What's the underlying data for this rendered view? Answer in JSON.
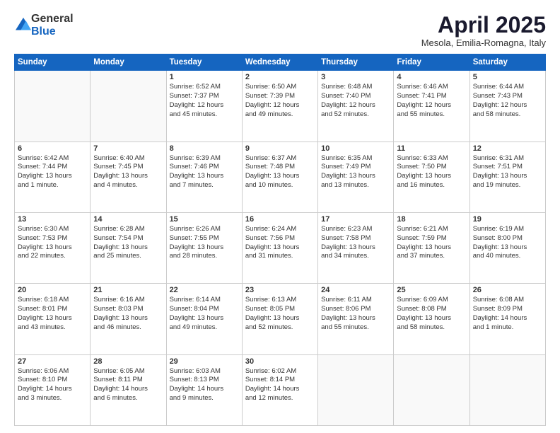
{
  "header": {
    "logo_general": "General",
    "logo_blue": "Blue",
    "month_title": "April 2025",
    "location": "Mesola, Emilia-Romagna, Italy"
  },
  "days_of_week": [
    "Sunday",
    "Monday",
    "Tuesday",
    "Wednesday",
    "Thursday",
    "Friday",
    "Saturday"
  ],
  "weeks": [
    [
      {
        "day": "",
        "content": ""
      },
      {
        "day": "",
        "content": ""
      },
      {
        "day": "1",
        "content": "Sunrise: 6:52 AM\nSunset: 7:37 PM\nDaylight: 12 hours\nand 45 minutes."
      },
      {
        "day": "2",
        "content": "Sunrise: 6:50 AM\nSunset: 7:39 PM\nDaylight: 12 hours\nand 49 minutes."
      },
      {
        "day": "3",
        "content": "Sunrise: 6:48 AM\nSunset: 7:40 PM\nDaylight: 12 hours\nand 52 minutes."
      },
      {
        "day": "4",
        "content": "Sunrise: 6:46 AM\nSunset: 7:41 PM\nDaylight: 12 hours\nand 55 minutes."
      },
      {
        "day": "5",
        "content": "Sunrise: 6:44 AM\nSunset: 7:43 PM\nDaylight: 12 hours\nand 58 minutes."
      }
    ],
    [
      {
        "day": "6",
        "content": "Sunrise: 6:42 AM\nSunset: 7:44 PM\nDaylight: 13 hours\nand 1 minute."
      },
      {
        "day": "7",
        "content": "Sunrise: 6:40 AM\nSunset: 7:45 PM\nDaylight: 13 hours\nand 4 minutes."
      },
      {
        "day": "8",
        "content": "Sunrise: 6:39 AM\nSunset: 7:46 PM\nDaylight: 13 hours\nand 7 minutes."
      },
      {
        "day": "9",
        "content": "Sunrise: 6:37 AM\nSunset: 7:48 PM\nDaylight: 13 hours\nand 10 minutes."
      },
      {
        "day": "10",
        "content": "Sunrise: 6:35 AM\nSunset: 7:49 PM\nDaylight: 13 hours\nand 13 minutes."
      },
      {
        "day": "11",
        "content": "Sunrise: 6:33 AM\nSunset: 7:50 PM\nDaylight: 13 hours\nand 16 minutes."
      },
      {
        "day": "12",
        "content": "Sunrise: 6:31 AM\nSunset: 7:51 PM\nDaylight: 13 hours\nand 19 minutes."
      }
    ],
    [
      {
        "day": "13",
        "content": "Sunrise: 6:30 AM\nSunset: 7:53 PM\nDaylight: 13 hours\nand 22 minutes."
      },
      {
        "day": "14",
        "content": "Sunrise: 6:28 AM\nSunset: 7:54 PM\nDaylight: 13 hours\nand 25 minutes."
      },
      {
        "day": "15",
        "content": "Sunrise: 6:26 AM\nSunset: 7:55 PM\nDaylight: 13 hours\nand 28 minutes."
      },
      {
        "day": "16",
        "content": "Sunrise: 6:24 AM\nSunset: 7:56 PM\nDaylight: 13 hours\nand 31 minutes."
      },
      {
        "day": "17",
        "content": "Sunrise: 6:23 AM\nSunset: 7:58 PM\nDaylight: 13 hours\nand 34 minutes."
      },
      {
        "day": "18",
        "content": "Sunrise: 6:21 AM\nSunset: 7:59 PM\nDaylight: 13 hours\nand 37 minutes."
      },
      {
        "day": "19",
        "content": "Sunrise: 6:19 AM\nSunset: 8:00 PM\nDaylight: 13 hours\nand 40 minutes."
      }
    ],
    [
      {
        "day": "20",
        "content": "Sunrise: 6:18 AM\nSunset: 8:01 PM\nDaylight: 13 hours\nand 43 minutes."
      },
      {
        "day": "21",
        "content": "Sunrise: 6:16 AM\nSunset: 8:03 PM\nDaylight: 13 hours\nand 46 minutes."
      },
      {
        "day": "22",
        "content": "Sunrise: 6:14 AM\nSunset: 8:04 PM\nDaylight: 13 hours\nand 49 minutes."
      },
      {
        "day": "23",
        "content": "Sunrise: 6:13 AM\nSunset: 8:05 PM\nDaylight: 13 hours\nand 52 minutes."
      },
      {
        "day": "24",
        "content": "Sunrise: 6:11 AM\nSunset: 8:06 PM\nDaylight: 13 hours\nand 55 minutes."
      },
      {
        "day": "25",
        "content": "Sunrise: 6:09 AM\nSunset: 8:08 PM\nDaylight: 13 hours\nand 58 minutes."
      },
      {
        "day": "26",
        "content": "Sunrise: 6:08 AM\nSunset: 8:09 PM\nDaylight: 14 hours\nand 1 minute."
      }
    ],
    [
      {
        "day": "27",
        "content": "Sunrise: 6:06 AM\nSunset: 8:10 PM\nDaylight: 14 hours\nand 3 minutes."
      },
      {
        "day": "28",
        "content": "Sunrise: 6:05 AM\nSunset: 8:11 PM\nDaylight: 14 hours\nand 6 minutes."
      },
      {
        "day": "29",
        "content": "Sunrise: 6:03 AM\nSunset: 8:13 PM\nDaylight: 14 hours\nand 9 minutes."
      },
      {
        "day": "30",
        "content": "Sunrise: 6:02 AM\nSunset: 8:14 PM\nDaylight: 14 hours\nand 12 minutes."
      },
      {
        "day": "",
        "content": ""
      },
      {
        "day": "",
        "content": ""
      },
      {
        "day": "",
        "content": ""
      }
    ]
  ]
}
